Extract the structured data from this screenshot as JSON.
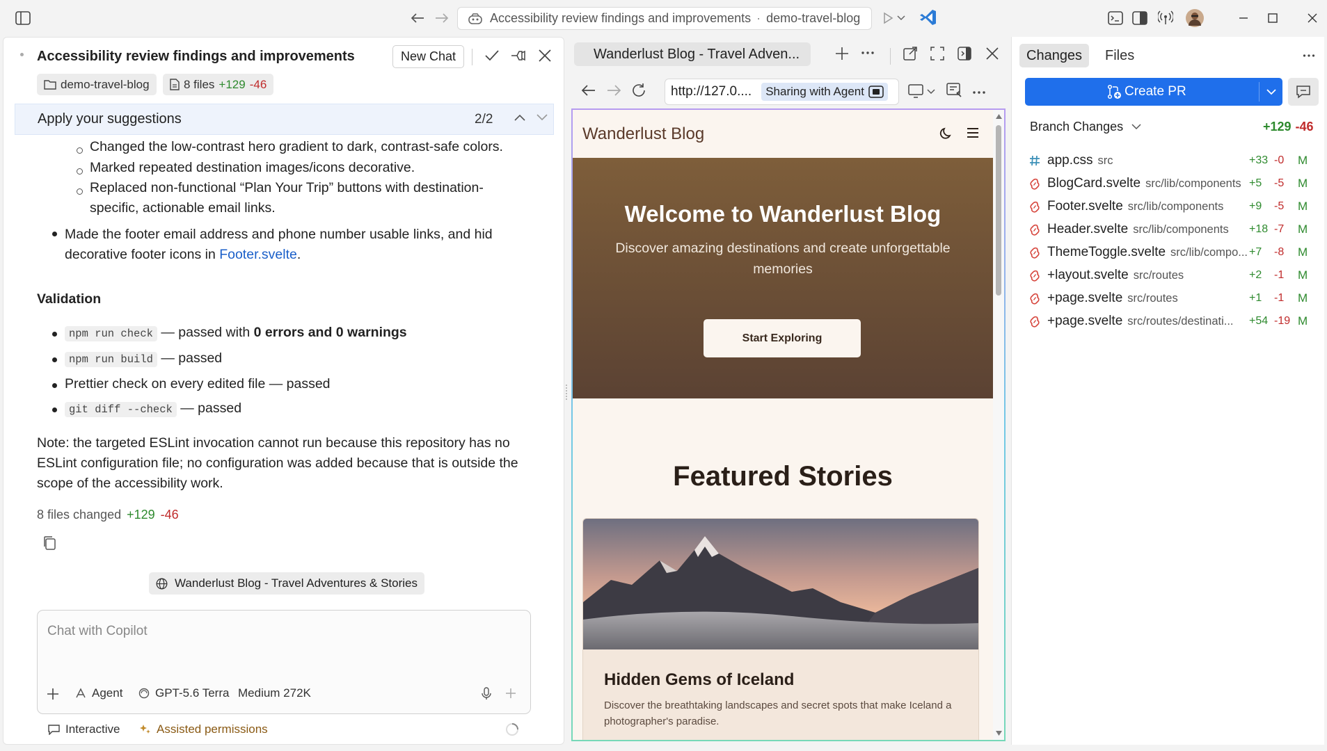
{
  "window": {
    "title": "Accessibility review findings and improvements",
    "project": "demo-travel-blog"
  },
  "chat": {
    "title": "Accessibility review findings and improvements",
    "new_chat_label": "New Chat",
    "folder_chip": "demo-travel-blog",
    "files_chip": "8 files",
    "files_added": "+129",
    "files_removed": "-46",
    "suggestion_bar": "Apply your suggestions",
    "suggestion_count": "2/2",
    "sub_bullets": [
      "Changed the low-contrast hero gradient to dark, contrast-safe colors.",
      "Marked repeated destination images/icons decorative.",
      "Replaced non-functional “Plan Your Trip” buttons with destination-",
      "specific, actionable email links."
    ],
    "footer_bullet_line1": "Made the footer email address and phone number usable links, and hid",
    "footer_bullet_line2_prefix": "decorative footer icons in ",
    "footer_bullet_link": "Footer.svelte",
    "footer_bullet_line2_suffix": ".",
    "validation_heading": "Validation",
    "validation_items": [
      {
        "code": "npm run check",
        "text_prefix": " — passed with ",
        "bold": "0 errors and 0 warnings"
      },
      {
        "code": "npm run build",
        "text_prefix": " — passed",
        "bold": ""
      },
      {
        "code": "",
        "text_prefix": "Prettier check on every edited file — passed",
        "bold": ""
      },
      {
        "code": "git diff --check",
        "text_prefix": " — passed",
        "bold": ""
      }
    ],
    "note_lines": [
      "Note: the targeted ESLint invocation cannot run because this repository has no",
      "ESLint configuration file; no configuration was added because that is outside the",
      "scope of the accessibility work."
    ],
    "files_changed_label": "8 files changed",
    "files_changed_added": "+129",
    "files_changed_removed": "-46",
    "reference_chip": "Wanderlust Blog - Travel Adventures & Stories",
    "input_placeholder": "Chat with Copilot",
    "agent_label": "Agent",
    "model_label": "GPT-5.6 Terra",
    "context_label": "Medium 272K",
    "interactive_label": "Interactive",
    "permissions_label": "Assisted permissions"
  },
  "browser": {
    "tab_title": "Wanderlust Blog - Travel Adven...",
    "url": "http://127.0....",
    "sharing_label": "Sharing with Agent",
    "site": {
      "brand": "Wanderlust Blog",
      "hero_title": "Welcome to Wanderlust Blog",
      "hero_subtitle": "Discover amazing destinations and create unforgettable memories",
      "hero_button": "Start Exploring",
      "featured_heading": "Featured Stories",
      "card_title": "Hidden Gems of Iceland",
      "card_desc": "Discover the breathtaking landscapes and secret spots that make Iceland a photographer's paradise."
    }
  },
  "changes": {
    "tab_changes": "Changes",
    "tab_files": "Files",
    "create_pr_label": "Create PR",
    "branch_label": "Branch Changes",
    "branch_added": "+129",
    "branch_removed": "-46",
    "files": [
      {
        "name": "app.css",
        "path": "src",
        "added": "+33",
        "removed": "-0",
        "status": "M",
        "icon": "hash-icon"
      },
      {
        "name": "BlogCard.svelte",
        "path": "src/lib/components",
        "added": "+5",
        "removed": "-5",
        "status": "M",
        "icon": "svelte-icon"
      },
      {
        "name": "Footer.svelte",
        "path": "src/lib/components",
        "added": "+9",
        "removed": "-5",
        "status": "M",
        "icon": "svelte-icon"
      },
      {
        "name": "Header.svelte",
        "path": "src/lib/components",
        "added": "+18",
        "removed": "-7",
        "status": "M",
        "icon": "svelte-icon"
      },
      {
        "name": "ThemeToggle.svelte",
        "path": "src/lib/compo...",
        "added": "+7",
        "removed": "-8",
        "status": "M",
        "icon": "svelte-icon"
      },
      {
        "name": "+layout.svelte",
        "path": "src/routes",
        "added": "+2",
        "removed": "-1",
        "status": "M",
        "icon": "svelte-icon"
      },
      {
        "name": "+page.svelte",
        "path": "src/routes",
        "added": "+1",
        "removed": "-1",
        "status": "M",
        "icon": "svelte-icon"
      },
      {
        "name": "+page.svelte",
        "path": "src/routes/destinati...",
        "added": "+54",
        "removed": "-19",
        "status": "M",
        "icon": "svelte-icon"
      }
    ]
  },
  "colors": {
    "accent_blue": "#1f6feb",
    "added_green": "#2e8a2e",
    "removed_red": "#c02b2b",
    "hero_brown": "#6b4f37"
  }
}
